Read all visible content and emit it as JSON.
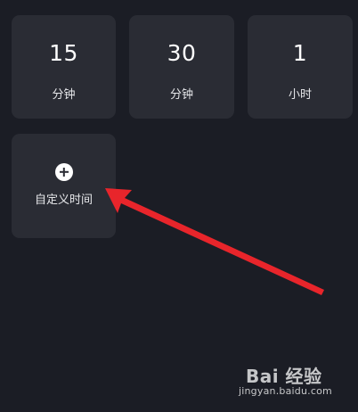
{
  "tiles": [
    {
      "value": "15",
      "unit": "分钟"
    },
    {
      "value": "30",
      "unit": "分钟"
    },
    {
      "value": "1",
      "unit": "小时"
    }
  ],
  "custom": {
    "label": "自定义时间",
    "icon": "plus-circle-icon"
  },
  "annotation": {
    "icon": "red-arrow-icon",
    "color": "#e8252b"
  },
  "watermark": {
    "logo": "Bai 经验",
    "url": "jingyan.baidu.com"
  },
  "colors": {
    "background": "#1b1d25",
    "tile": "#2a2c34",
    "text": "#ffffff"
  }
}
